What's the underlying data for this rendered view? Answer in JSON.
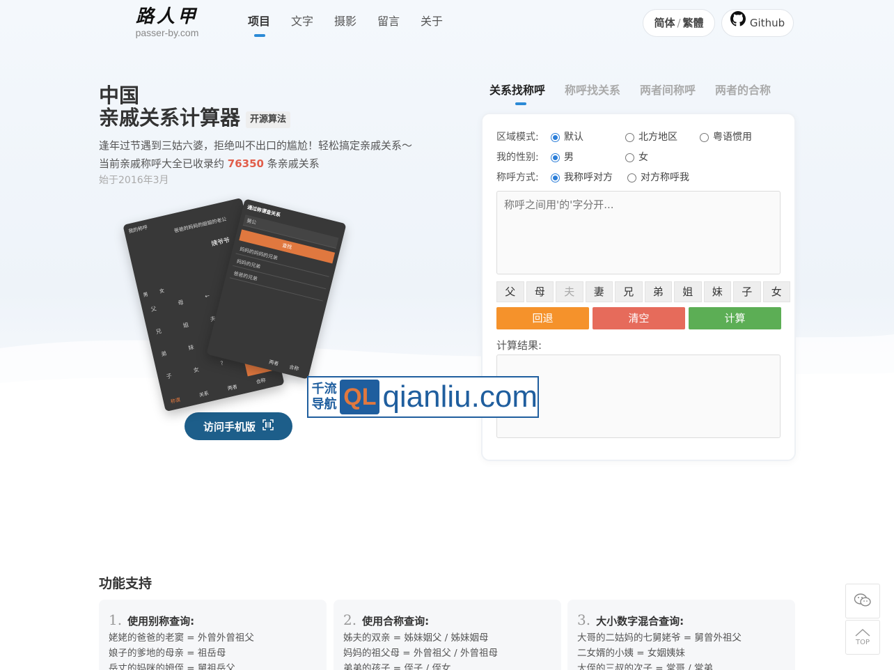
{
  "logo": {
    "cn": "路人甲",
    "en": "passer-by.com"
  },
  "nav": [
    "项目",
    "文字",
    "摄影",
    "留言",
    "关于"
  ],
  "header": {
    "lang_simplified": "简体",
    "lang_sep": "/",
    "lang_traditional": "繁體",
    "github": "Github"
  },
  "intro": {
    "title_line1": "中国",
    "title_line2": "亲戚关系计算器",
    "badge": "开源算法",
    "desc_line1": "逢年过节遇到三姑六婆，拒绝叫不出口的尴尬！轻松搞定亲戚关系～",
    "desc_line2_prefix": "当前亲戚称呼大全已收录约",
    "desc_count": "76350",
    "desc_line2_suffix": "条亲戚关系",
    "since": "始于2016年3月",
    "mobile_button": "访问手机版"
  },
  "phone_a": {
    "top_left": "我的称呼",
    "top_right": "爸爸的妈妈的姐姐的老公",
    "result": "姨爷爷",
    "gender_m": "男",
    "gender_f": "女",
    "keys": [
      "父",
      "母",
      "兄",
      "姐",
      "弟",
      "妹",
      "子",
      "女",
      "夫",
      "妻",
      "?",
      "⇦",
      "←",
      "↻",
      "="
    ],
    "bottom": [
      "称谓",
      "关系",
      "两者",
      "合称"
    ]
  },
  "phone_b": {
    "header": "通过称谓查关系",
    "input": "舅公",
    "button": "查找",
    "rows": [
      "妈妈的妈妈的兄弟",
      "妈妈的兄弟",
      "爸爸的兄弟"
    ],
    "bottom": [
      "两者",
      "合称"
    ]
  },
  "watermark": {
    "cn_line1": "千流",
    "cn_line2": "导航",
    "ql": "QL",
    "en": "qianliu.com"
  },
  "tabs": [
    "关系找称呼",
    "称呼找关系",
    "两者间称呼",
    "两者的合称"
  ],
  "form": {
    "region_label": "区域模式:",
    "region_options": [
      "默认",
      "北方地区",
      "粤语惯用"
    ],
    "gender_label": "我的性别:",
    "gender_options": [
      "男",
      "女"
    ],
    "call_label": "称呼方式:",
    "call_options": [
      "我称呼对方",
      "对方称呼我"
    ],
    "placeholder": "称呼之间用'的'字分开...",
    "keys": [
      "父",
      "母",
      "夫",
      "妻",
      "兄",
      "弟",
      "姐",
      "妹",
      "子",
      "女"
    ],
    "back": "回退",
    "clear": "清空",
    "calc": "计算",
    "result_label": "计算结果:"
  },
  "features": {
    "heading": "功能支持",
    "cards": [
      {
        "num": "1.",
        "title": "使用别称查询:",
        "lines": [
          "姥姥的爸爸的老窦 = 外曾外曾祖父",
          "娘子的爹地的母亲 = 祖岳母",
          "岳丈的妈咪的姆侄 = 舅祖岳父"
        ]
      },
      {
        "num": "2.",
        "title": "使用合称查询:",
        "lines": [
          "姊夫的双亲 = 姊妹姻父 / 姊妹姻母",
          "妈妈的祖父母 = 外曾祖父 / 外曾祖母",
          "弟弟的孩子 = 侄子 / 侄女"
        ]
      },
      {
        "num": "3.",
        "title": "大小数字混合查询:",
        "lines": [
          "大哥的二姑妈的七舅姥爷 = 舅曾外祖父",
          "二女婿的小姨 = 女姻姨妹",
          "大侄的三叔的次子 = 堂哥 / 堂弟"
        ]
      }
    ]
  },
  "side": {
    "top": "TOP"
  }
}
